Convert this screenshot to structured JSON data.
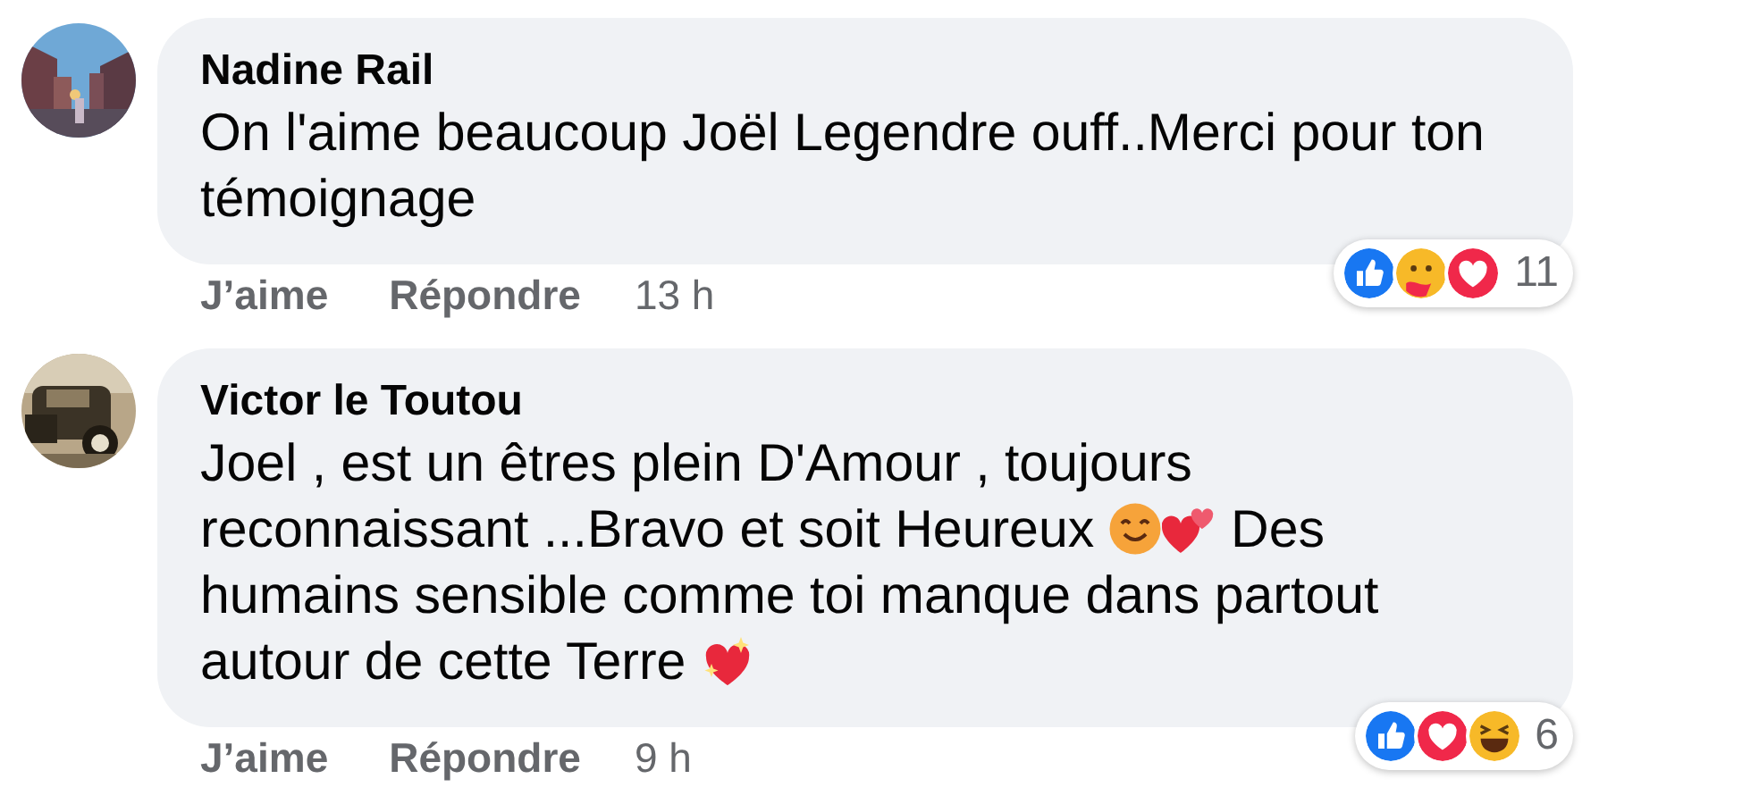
{
  "comments": [
    {
      "author": "Nadine Rail",
      "avatar": {
        "kind": "picture"
      },
      "body": [
        {
          "kind": "text",
          "text": "On l'aime beaucoup Joël Legendre ouff..Merci pour ton témoignage"
        }
      ],
      "actions": [
        "J’aime",
        "Répondre"
      ],
      "time": "13 h",
      "reactions": [
        {
          "kind": "like"
        },
        {
          "kind": "care"
        },
        {
          "kind": "love"
        }
      ],
      "reaction_count": "11"
    },
    {
      "author": "Victor le Toutou",
      "avatar": {
        "kind": "picture"
      },
      "body": [
        {
          "kind": "text",
          "text": "Joel , est un êtres plein D'Amour , toujours reconnaissant ...Bravo et soit Heureux "
        },
        {
          "kind": "smile"
        },
        {
          "kind": "hearts"
        },
        {
          "kind": "text",
          "text": " Des humains sensible comme toi manque dans partout autour de cette Terre "
        },
        {
          "kind": "sparkle_heart"
        }
      ],
      "actions": [
        "J’aime",
        "Répondre"
      ],
      "time": "9 h",
      "reactions": [
        {
          "kind": "like"
        },
        {
          "kind": "love"
        },
        {
          "kind": "haha"
        }
      ],
      "reaction_count": "6"
    }
  ]
}
